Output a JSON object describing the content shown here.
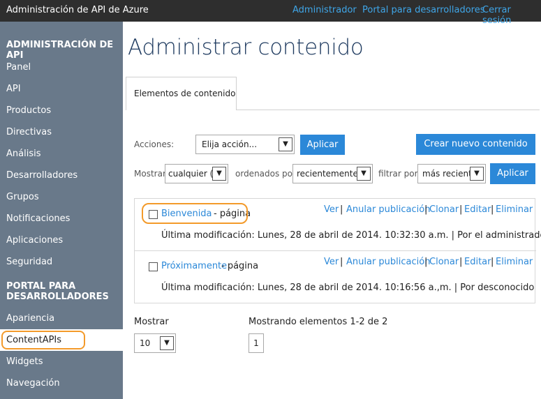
{
  "topbar": {
    "title": "Administración de API de Azure",
    "links": [
      "Administrador",
      "Portal para desarrolladores",
      "Cerrar sesión"
    ]
  },
  "sidebar": {
    "section1": "ADMINISTRACIÓN DE API",
    "items1": [
      "Panel",
      "API",
      "Productos",
      "Directivas",
      "Análisis",
      "Desarrolladores",
      "Grupos",
      "Notificaciones",
      "Aplicaciones",
      "Seguridad"
    ],
    "section2_line1": "PORTAL PARA",
    "section2_line2": "DESARROLLADORES",
    "items2": [
      "Apariencia",
      "ContentAPIs",
      "Widgets",
      "Navegación"
    ]
  },
  "main": {
    "title": "Administrar contenido",
    "tab": "Elementos de contenido",
    "actions_label": "Acciones:",
    "actions_select": "Elija acción...",
    "apply_label": "Aplicar",
    "create_label": "Crear nuevo contenido",
    "show_label": "Mostrar",
    "show_select": "cualquier (...",
    "ordered_label": "ordenados por",
    "ordered_select": "recientemente...",
    "filter_label": "filtrar por",
    "filter_select": "más reciente",
    "apply2_label": "Aplicar"
  },
  "items": [
    {
      "name": "Bienvenida",
      "type": "- página",
      "meta": "Última modificación: Lunes, 28 de abril de 2014. 10:32:30 a.m. | Por el administrador"
    },
    {
      "name": "Próximamente",
      "type": "- página",
      "meta": "Última modificación: Lunes, 28 de abril de 2014. 10:16:56 a.,m. | Por desconocido"
    }
  ],
  "row_actions": [
    "Ver",
    "Anular publicación",
    "Clonar",
    "Editar",
    "Eliminar"
  ],
  "pager": {
    "show_label": "Mostrar",
    "page_size": "10",
    "showing_text": "Mostrando elementos 1-2 de 2",
    "current_page": "1"
  },
  "colors": {
    "accent": "#2b88d8",
    "sidebar": "#69798a",
    "highlight": "#f39a2a",
    "topbar": "#2e2e2e"
  }
}
